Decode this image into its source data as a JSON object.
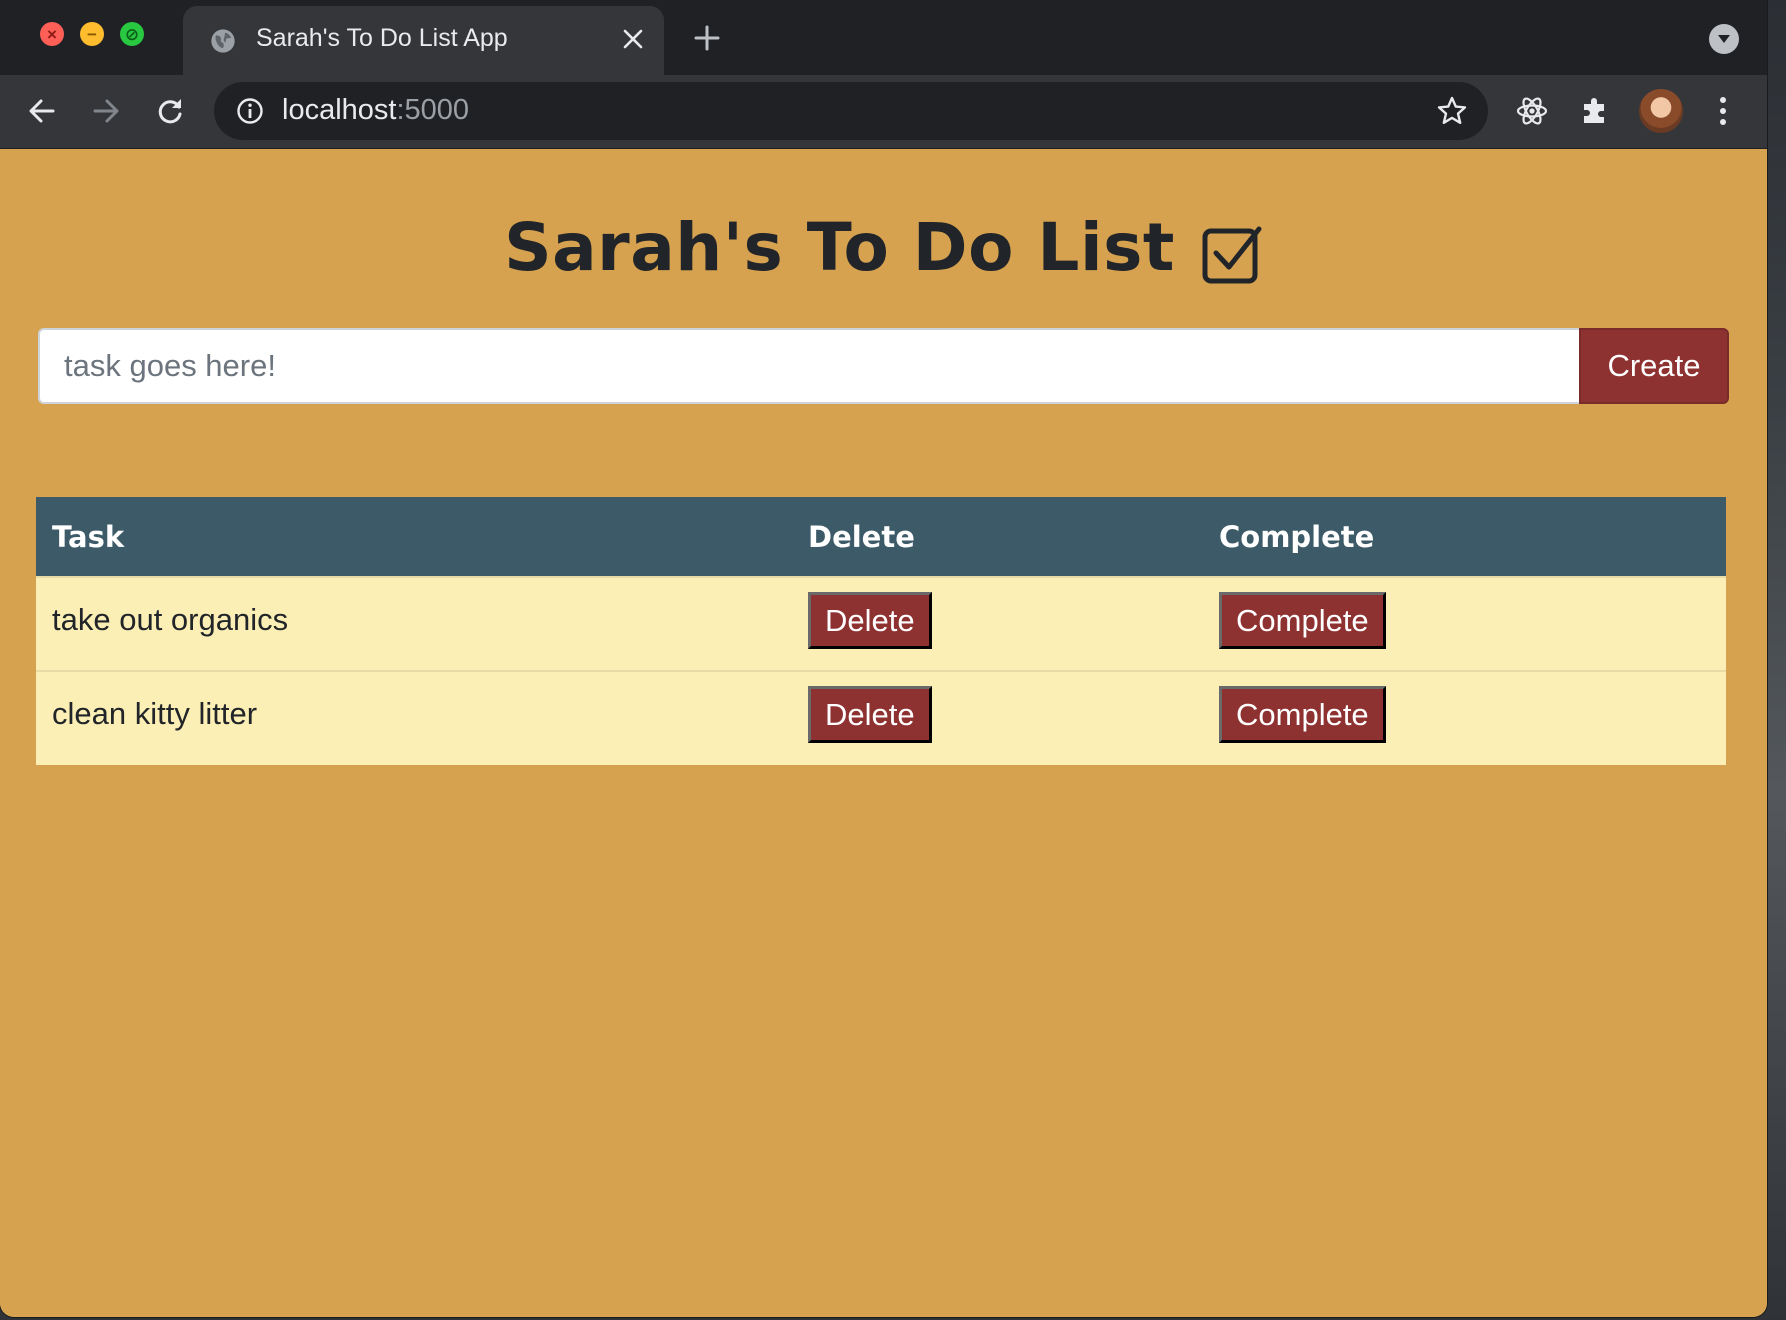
{
  "browser": {
    "tab_title": "Sarah's To Do List App",
    "url_host": "localhost",
    "url_port": ":5000",
    "icons": {
      "back": "arrow-left-icon",
      "forward": "arrow-right-icon",
      "reload": "reload-icon",
      "info": "info-icon",
      "bookmark": "star-icon",
      "extension_react": "atom-icon",
      "extensions": "puzzle-icon",
      "menu": "more-vert-icon"
    }
  },
  "app": {
    "title": "Sarah's To Do List",
    "title_icon": "checkbox-checked-icon",
    "input_placeholder": "task goes here!",
    "create_label": "Create",
    "table": {
      "headers": [
        "Task",
        "Delete",
        "Complete"
      ],
      "rows": [
        {
          "task": "take out organics",
          "delete_label": "Delete",
          "complete_label": "Complete"
        },
        {
          "task": "clean kitty litter",
          "delete_label": "Delete",
          "complete_label": "Complete"
        }
      ]
    }
  },
  "colors": {
    "page_background": "#d6a24f",
    "header_background": "#3d5a68",
    "row_background": "#fcefb5",
    "button_background": "#8e3131"
  }
}
